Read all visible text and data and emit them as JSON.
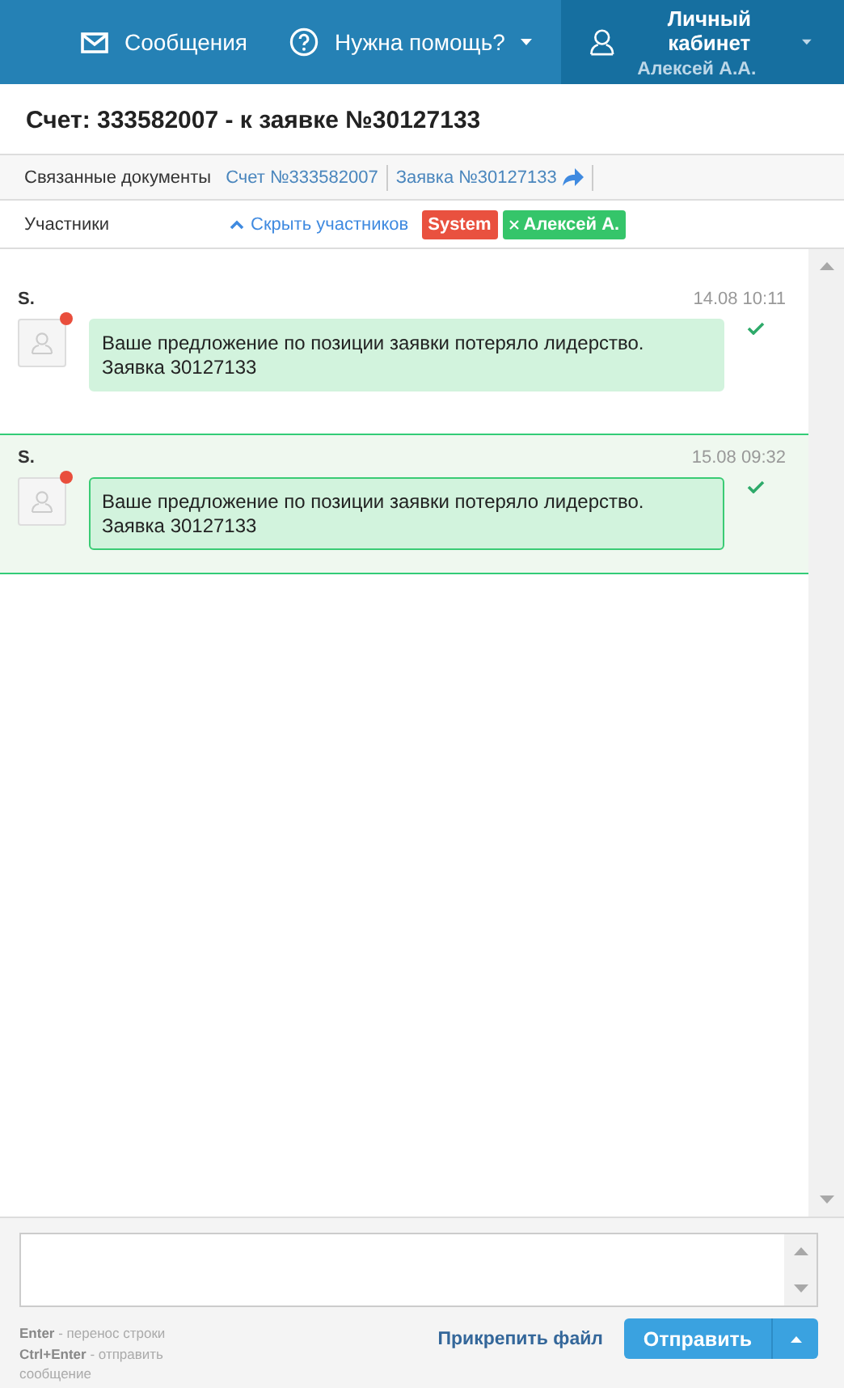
{
  "header": {
    "messages": "Сообщения",
    "help": "Нужна помощь?",
    "account_title": "Личный кабинет",
    "account_user": "Алексей А.А."
  },
  "title": "Счет: 333582007 - к заявке №30127133",
  "related": {
    "label": "Связанные документы",
    "links": [
      {
        "text": "Счет №333582007",
        "kind": "plain"
      },
      {
        "text": "Заявка №30127133",
        "kind": "share"
      }
    ]
  },
  "participants": {
    "label": "Участники",
    "toggle": "Скрыть участников",
    "tags": [
      {
        "text": "System",
        "color": "#e9513f",
        "removable": false
      },
      {
        "text": "Алексей А.",
        "color": "#35c56a",
        "removable": true
      }
    ]
  },
  "messages": [
    {
      "author": "S.",
      "time": "14.08 10:11",
      "text": "Ваше предложение по позиции заявки потеряло лидерство. Заявка 30127133",
      "unread": true,
      "delivered": true,
      "selected": false
    },
    {
      "author": "S.",
      "time": "15.08 09:32",
      "text": "Ваше предложение по позиции заявки потеряло лидерство. Заявка 30127133",
      "unread": true,
      "delivered": true,
      "selected": true
    }
  ],
  "composer": {
    "hints": [
      "**Enter** - перенос строки",
      "**Ctrl+Enter** - отправить сообщение"
    ],
    "attach": "Прикрепить файл",
    "send": "Отправить"
  }
}
